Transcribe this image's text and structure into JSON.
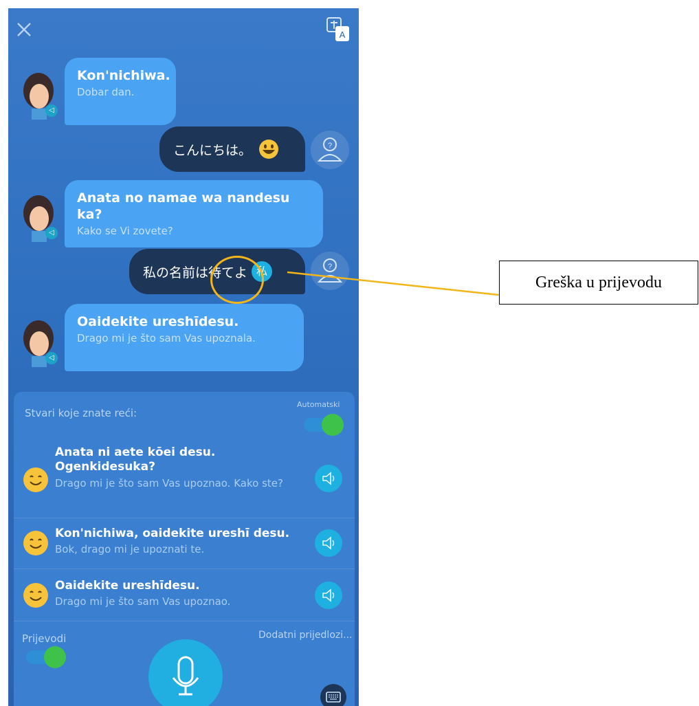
{
  "header": {
    "close_icon": "close-icon",
    "translate_icon": "translate-icon"
  },
  "chat": {
    "messages": [
      {
        "side": "left",
        "text": "Kon'nichiwa.",
        "translation": "Dobar dan."
      },
      {
        "side": "right",
        "text": "こんにちは。",
        "emoji": "grinning-face-icon"
      },
      {
        "side": "left",
        "text": "Anata no namae wa nandesu ka?",
        "translation": "Kako se Vi zovete?"
      },
      {
        "side": "right",
        "text": "私の名前は待てよ",
        "badge": "私"
      },
      {
        "side": "left",
        "text": "Oaidekite ureshīdesu.",
        "translation": "Drago mi je što sam Vas upoznala."
      }
    ]
  },
  "annotation": {
    "label": "Greška u prijevodu",
    "color": "#f2b51a"
  },
  "panel": {
    "title": "Stvari koje znate reći:",
    "auto_label": "Automatski",
    "suggestions": [
      {
        "text": "Anata ni aete kōei desu. Ogenkidesuka?",
        "translation": "Drago mi je što sam Vas upoznao. Kako ste?"
      },
      {
        "text": "Kon'nichiwa, oaidekite ureshī desu.",
        "translation": "Bok, drago mi je upoznati te."
      },
      {
        "text": "Oaidekite ureshīdesu.",
        "translation": "Drago mi je što sam Vas upoznao."
      }
    ],
    "translations_label": "Prijevodi",
    "more_suggestions_label": "Dodatni prijedlozi..."
  },
  "colors": {
    "background": "#3a7ac9",
    "bot_bubble": "#4aa3f3",
    "user_bubble": "#1d3557",
    "toggle_on": "#3fc24a",
    "action": "#21aee0"
  }
}
